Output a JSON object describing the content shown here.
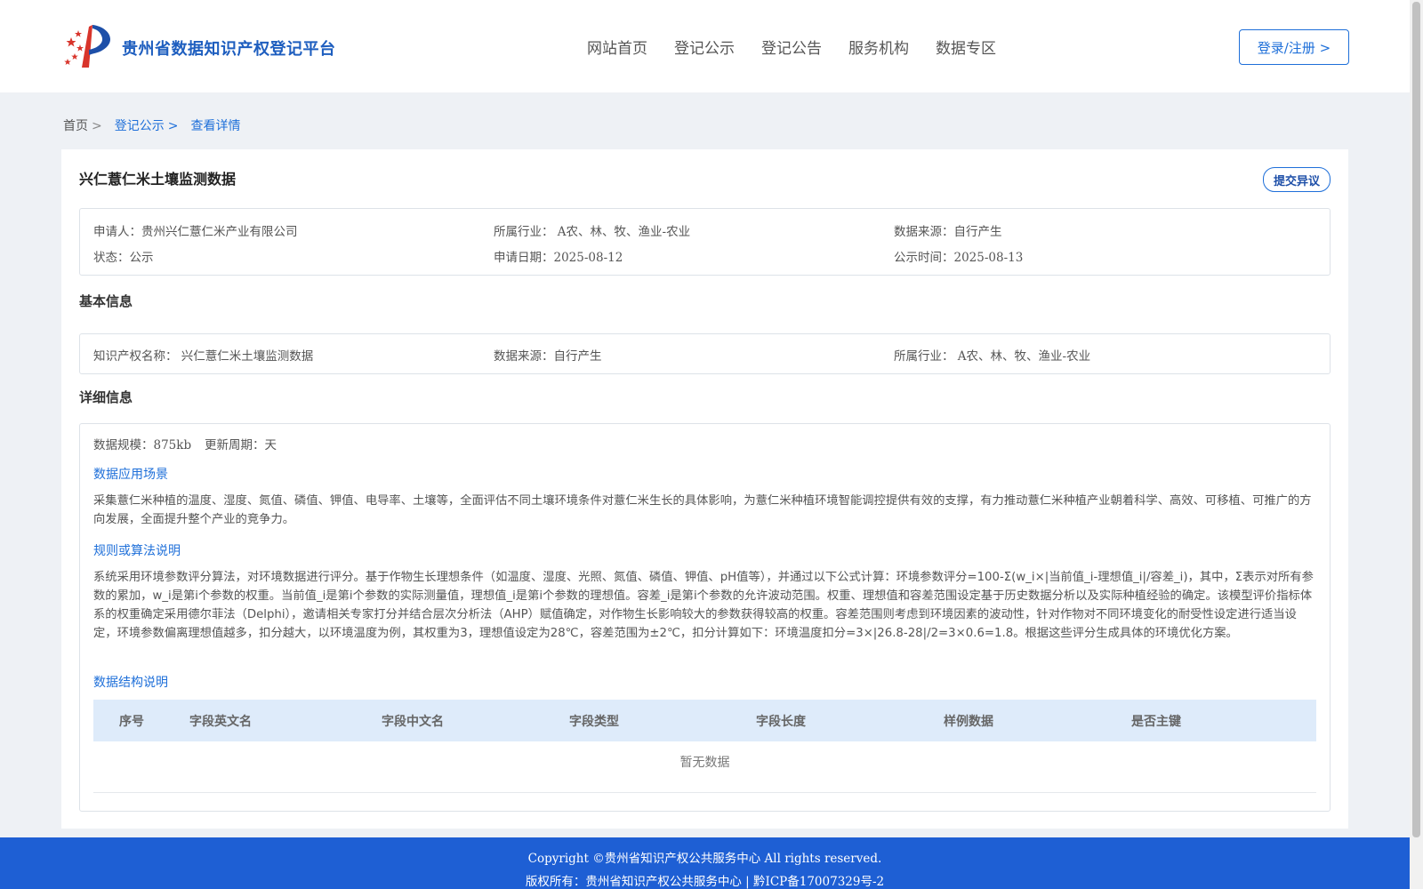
{
  "header": {
    "site_title": "贵州省数据知识产权登记平台",
    "nav": [
      "网站首页",
      "登记公示",
      "登记公告",
      "服务机构",
      "数据专区"
    ],
    "login_label": "登录/注册 >"
  },
  "breadcrumb": {
    "home": "首页",
    "list": "登记公示",
    "current": "查看详情",
    "sep": ">"
  },
  "record": {
    "title": "兴仁薏仁米土壤监测数据",
    "objection_label": "提交异议",
    "summary": {
      "applicant_label": "申请人：",
      "applicant": "贵州兴仁薏仁米产业有限公司",
      "industry_label": "所属行业：",
      "industry": "A农、林、牧、渔业-农业",
      "source_label": "数据来源：",
      "source": "自行产生",
      "status_label": "状态：",
      "status": "公示",
      "apply_date_label": "申请日期：",
      "apply_date": "2025-08-12",
      "publish_time_label": "公示时间：",
      "publish_time": "2025-08-13"
    }
  },
  "basic": {
    "section_title": "基本信息",
    "ip_name_label": "知识产权名称：",
    "ip_name": "兴仁薏仁米土壤监测数据",
    "source_label": "数据来源：",
    "source": "自行产生",
    "industry_label": "所属行业：",
    "industry": "A农、林、牧、渔业-农业"
  },
  "detail": {
    "section_title": "详细信息",
    "scale_label": "数据规模：",
    "scale": "875kb",
    "cycle_label": "更新周期：",
    "cycle": "天",
    "scenario_title": "数据应用场景",
    "scenario_text": "采集薏仁米种植的温度、湿度、氮值、磷值、钾值、电导率、土壤等，全面评估不同土壤环境条件对薏仁米生长的具体影响，为薏仁米种植环境智能调控提供有效的支撑，有力推动薏仁米种植产业朝着科学、高效、可移植、可推广的方向发展，全面提升整个产业的竞争力。",
    "algorithm_title": "规则或算法说明",
    "algorithm_text": "系统采用环境参数评分算法，对环境数据进行评分。基于作物生长理想条件（如温度、湿度、光照、氮值、磷值、钾值、pH值等），并通过以下公式计算：环境参数评分=100-Σ(w_i×|当前值_i-理想值_i|/容差_i)，其中，Σ表示对所有参数的累加，w_i是第i个参数的权重。当前值_i是第i个参数的实际测量值，理想值_i是第i个参数的理想值。容差_i是第i个参数的允许波动范围。权重、理想值和容差范围设定基于历史数据分析以及实际种植经验的确定。该模型评价指标体系的权重确定采用德尔菲法（Delphi），邀请相关专家打分并结合层次分析法（AHP）赋值确定，对作物生长影响较大的参数获得较高的权重。容差范围则考虑到环境因素的波动性，针对作物对不同环境变化的耐受性设定进行适当设定，环境参数偏离理想值越多，扣分越大，以环境温度为例，其权重为3，理想值设定为28℃，容差范围为±2℃，扣分计算如下：环境温度扣分=3×|26.8-28|/2=3×0.6=1.8。根据这些评分生成具体的环境优化方案。",
    "structure_title": "数据结构说明",
    "columns": [
      "序号",
      "字段英文名",
      "字段中文名",
      "字段类型",
      "字段长度",
      "样例数据",
      "是否主键"
    ],
    "empty_text": "暂无数据"
  },
  "footer": {
    "copyright": "Copyright ©贵州省知识产权公共服务中心 All rights reserved.",
    "owner": "版权所有：贵州省知识产权公共服务中心 | 黔ICP备17007329号-2"
  },
  "colors": {
    "accent": "#1e6fd9",
    "footer_bg": "#1e5fd4",
    "table_head_bg": "#deebfa",
    "page_bg": "#eef1f5"
  }
}
